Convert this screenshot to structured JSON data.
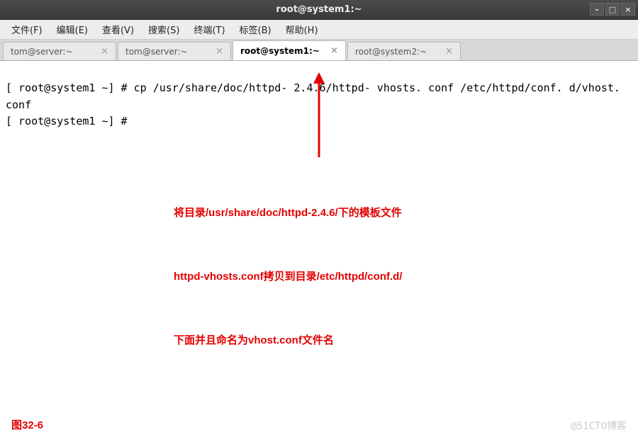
{
  "window": {
    "title": "root@system1:~"
  },
  "menu": {
    "file": "文件(F)",
    "edit": "编辑(E)",
    "view": "查看(V)",
    "search": "搜索(S)",
    "terminal": "终端(T)",
    "tabs": "标签(B)",
    "help": "帮助(H)"
  },
  "tabs": [
    {
      "label": "tom@server:~",
      "active": false
    },
    {
      "label": "tom@server:~",
      "active": false
    },
    {
      "label": "root@system1:~",
      "active": true
    },
    {
      "label": "root@system2:~",
      "active": false
    }
  ],
  "terminal": {
    "line1_prompt": "[ root@system1 ~] # ",
    "line1_cmd": "cp /usr/share/doc/httpd- 2.4.6/httpd- vhosts. conf /etc/httpd/conf. d/vhost. conf",
    "line2_prompt": "[ root@system1 ~] # "
  },
  "annotation": {
    "l1": "将目录/usr/share/doc/httpd-2.4.6/下的模板文件",
    "l2": "httpd-vhosts.conf拷贝到目录/etc/httpd/conf.d/",
    "l3": "下面并且命名为vhost.conf文件名"
  },
  "figure_label": "图32-6",
  "watermark": "@51CTO博客"
}
